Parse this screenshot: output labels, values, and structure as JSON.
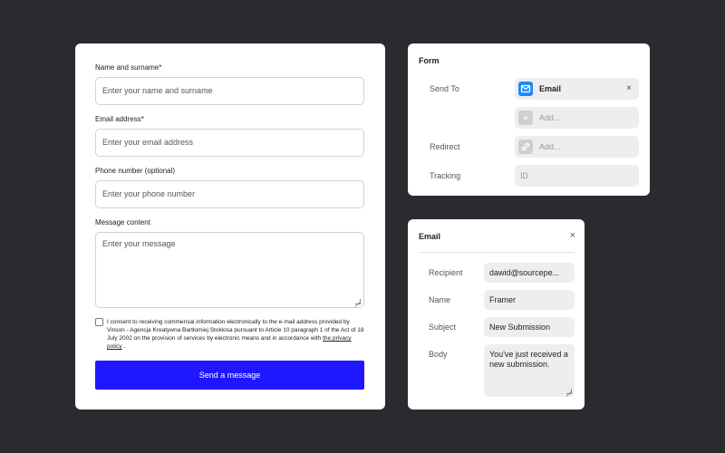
{
  "contact_form": {
    "name": {
      "label": "Name and surname*",
      "placeholder": "Enter your name and surname"
    },
    "email": {
      "label": "Email address*",
      "placeholder": "Enter your email address"
    },
    "phone": {
      "label": "Phone number (optional)",
      "placeholder": "Enter your phone number"
    },
    "message": {
      "label": "Message content",
      "placeholder": "Enter your message"
    },
    "consent_text": "I consent to receiving commercial information electronically to the e-mail address provided by Vinson - Agencja Kreatywna Bartłomiej Stoklosa pursuant to Article 10 paragraph 1 of the Act of 18 July 2002 on the provision of services by electronic means and in accordance with",
    "consent_link": "the privacy policy",
    "consent_end": ".",
    "submit_label": "Send a message",
    "submit_color": "#1f17ff"
  },
  "form_panel": {
    "title": "Form",
    "send_to_label": "Send To",
    "send_to_value": "Email",
    "send_to_icon": "mail-icon",
    "add_label": "Add...",
    "redirect_label": "Redirect",
    "redirect_value": "Add...",
    "tracking_label": "Tracking",
    "tracking_placeholder": "ID",
    "remove_symbol": "×"
  },
  "email_panel": {
    "title": "Email",
    "close_symbol": "×",
    "recipient_label": "Recipient",
    "recipient_value": "dawid@sourcepe...",
    "name_label": "Name",
    "name_value": "Framer",
    "subject_label": "Subject",
    "subject_value": "New Submission",
    "body_label": "Body",
    "body_value": "You've just received a new submission."
  }
}
